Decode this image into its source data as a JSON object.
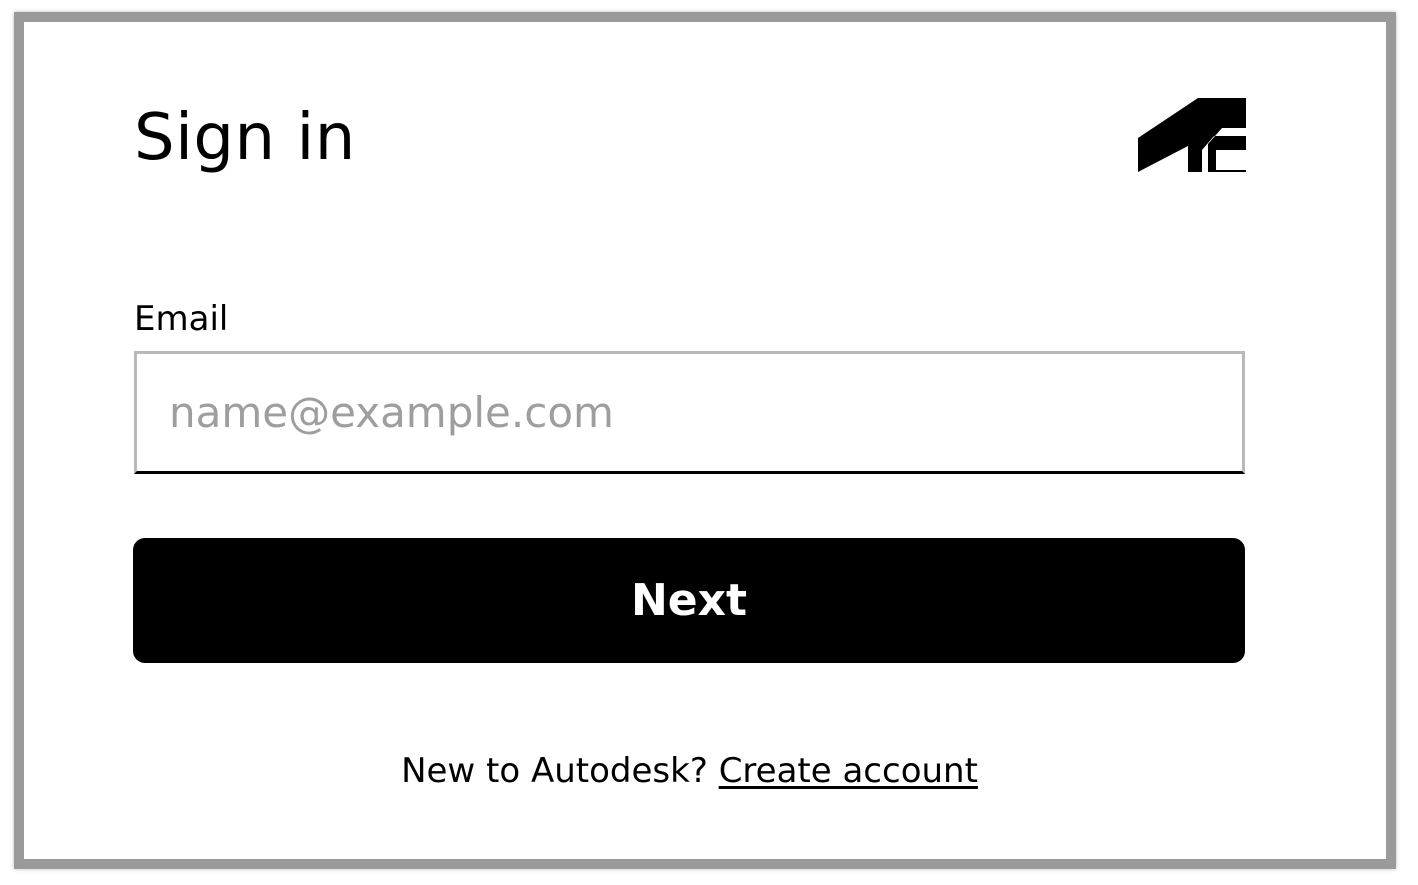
{
  "signin": {
    "title": "Sign in",
    "logo_icon": "autodesk-logo-icon",
    "email": {
      "label": "Email",
      "placeholder": "name@example.com",
      "value": ""
    },
    "next_label": "Next",
    "signup": {
      "prompt": "New to Autodesk? ",
      "link_label": "Create account"
    }
  },
  "colors": {
    "button_bg": "#000000",
    "button_text": "#ffffff",
    "input_border": "#b9b9b9",
    "placeholder": "#9e9e9e",
    "frame_border": "#9a9a9a"
  }
}
